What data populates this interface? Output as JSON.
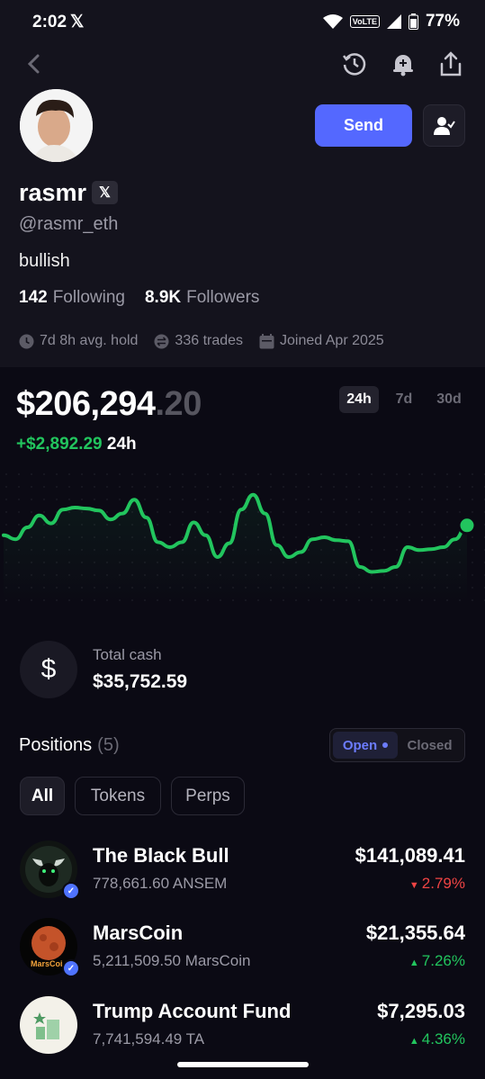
{
  "status_bar": {
    "time": "2:02",
    "x_label": "𝕏",
    "volte": "VoLTE",
    "battery": "77%"
  },
  "profile": {
    "name": "rasmr",
    "x_badge": "𝕏",
    "handle": "@rasmr_eth",
    "bio": "bullish",
    "following_count": "142",
    "following_label": "Following",
    "followers_count": "8.9K",
    "followers_label": "Followers",
    "avg_hold": "7d 8h avg. hold",
    "trades": "336 trades",
    "joined": "Joined Apr 2025",
    "send_label": "Send"
  },
  "portfolio": {
    "balance_main": "$206,294",
    "balance_dec": ".20",
    "change_amount": "+$2,892.29",
    "change_period": "24h",
    "ranges": [
      "24h",
      "7d",
      "30d"
    ],
    "active_range": "24h"
  },
  "chart_data": {
    "type": "line",
    "values": [
      52,
      48,
      60,
      72,
      64,
      78,
      80,
      79,
      77,
      68,
      74,
      88,
      70,
      45,
      40,
      45,
      65,
      52,
      30,
      44,
      78,
      93,
      74,
      42,
      30,
      35,
      48,
      50,
      47,
      46,
      20,
      15,
      16,
      20,
      40,
      37,
      38,
      40,
      48,
      62
    ],
    "color": "#22c55e"
  },
  "cash": {
    "label": "Total cash",
    "value": "$35,752.59",
    "icon": "dollar-icon"
  },
  "positions": {
    "title": "Positions",
    "count": "(5)",
    "open_label": "Open",
    "closed_label": "Closed",
    "filters": [
      "All",
      "Tokens",
      "Perps"
    ],
    "active_filter": "All",
    "items": [
      {
        "name": "The Black Bull",
        "amount": "778,661.60 ANSEM",
        "value": "$141,089.41",
        "change": "2.79%",
        "direction": "down"
      },
      {
        "name": "MarsCoin",
        "amount": "5,211,509.50 MarsCoin",
        "value": "$21,355.64",
        "change": "7.26%",
        "direction": "up",
        "icon_text": "MarsCoi"
      },
      {
        "name": "Trump Account Fund",
        "amount": "7,741,594.49 TA",
        "value": "$7,295.03",
        "change": "4.36%",
        "direction": "up"
      }
    ]
  }
}
